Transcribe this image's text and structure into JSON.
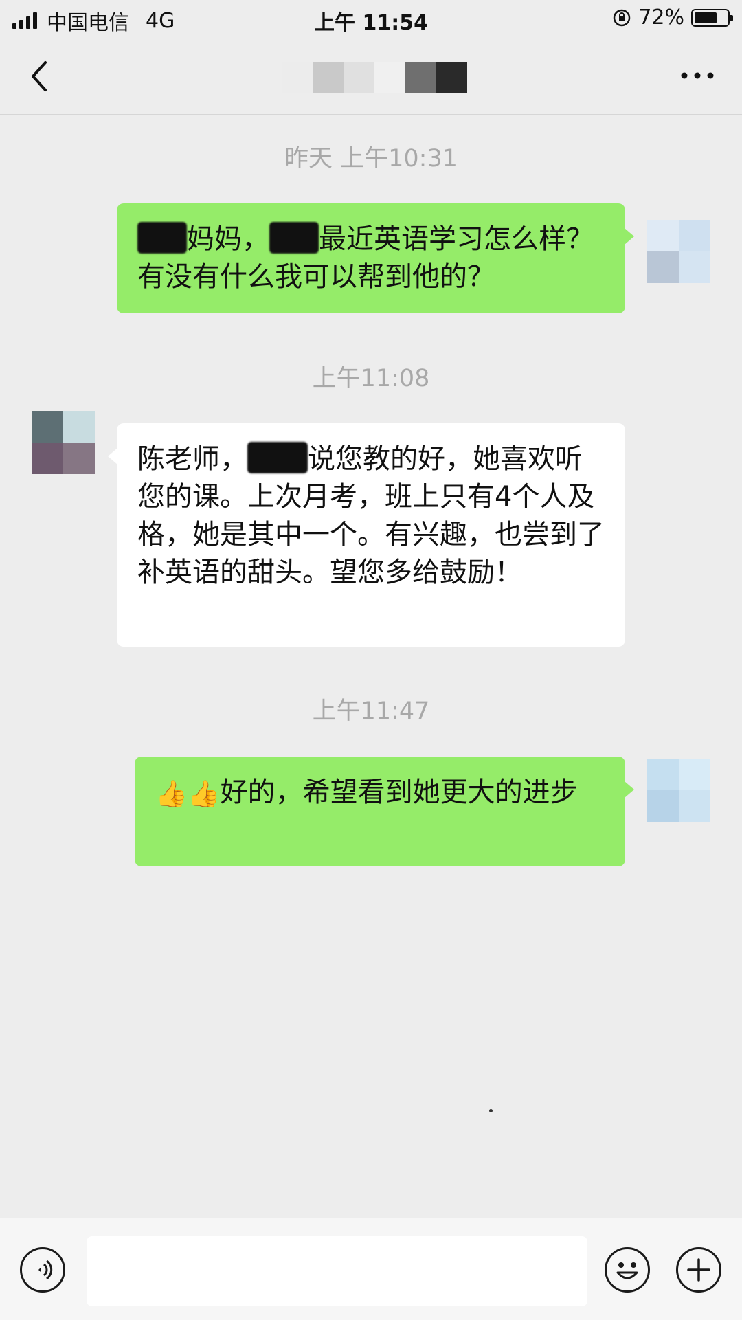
{
  "status_bar": {
    "carrier": "中国电信",
    "network": "4G",
    "time": "上午 11:54",
    "battery_percent": "72%",
    "battery_level": 0.72
  },
  "nav": {
    "back_icon": "chevron-left-icon",
    "more_icon": "ellipsis-icon"
  },
  "messages": [
    {
      "timestamp": "昨天 上午10:31",
      "sender": "self",
      "text_before": "",
      "text_mid": "妈妈，",
      "text_after": "最近英语学习怎么样？有没有什么我可以帮到他的？"
    },
    {
      "timestamp": "上午11:08",
      "sender": "other",
      "text_before": "陈老师，",
      "text_after": "说您教的好，她喜欢听您的课。上次月考，班上只有4个人及格，她是其中一个。有兴趣，也尝到了补英语的甜头。望您多给鼓励！"
    },
    {
      "timestamp": "上午11:47",
      "sender": "self",
      "emoji": "👍👍",
      "text": "好的，希望看到她更大的进步"
    }
  ],
  "input_bar": {
    "voice_icon": "voice-icon",
    "emoji_icon": "smiley-icon",
    "plus_icon": "plus-icon",
    "input_value": ""
  }
}
